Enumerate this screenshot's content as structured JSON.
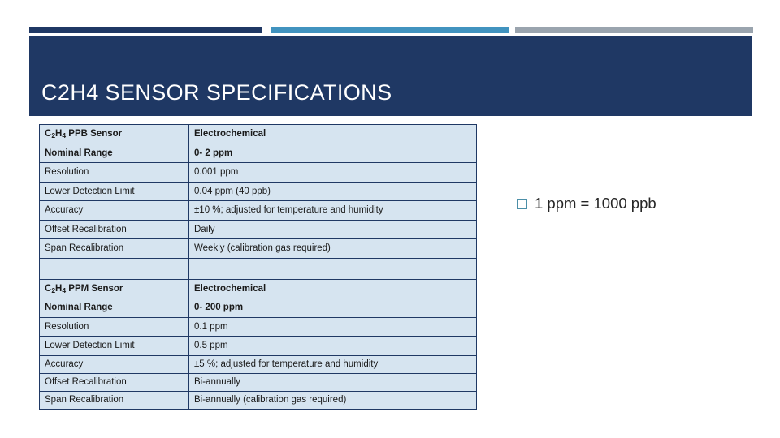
{
  "slide": {
    "title": "C2H4 SENSOR SPECIFICATIONS",
    "colors": {
      "navy": "#1f3864",
      "blue": "#4193bf",
      "gray": "#9aa4ae",
      "table_fill": "#d6e4f0",
      "bullet_outline": "#4c8fa8",
      "title_text": "#ffffff"
    }
  },
  "table": {
    "rows": [
      {
        "label_html": "C<sub>2</sub>H<sub>4</sub> PPB Sensor",
        "label_text": "C2H4 PPB Sensor",
        "value": "Electrochemical",
        "bold": true,
        "size": "tall"
      },
      {
        "label_html": "Nominal Range",
        "label_text": "Nominal Range",
        "value": "0- 2 ppm",
        "bold": true,
        "size": "tall"
      },
      {
        "label_html": "Resolution",
        "label_text": "Resolution",
        "value": "0.001 ppm",
        "bold": false,
        "size": "tall"
      },
      {
        "label_html": "Lower Detection Limit",
        "label_text": "Lower Detection Limit",
        "value": "0.04 ppm (40 ppb)",
        "bold": false,
        "size": "tall"
      },
      {
        "label_html": "Accuracy",
        "label_text": "Accuracy",
        "value": "±10 %; adjusted for temperature and humidity",
        "bold": false,
        "size": "tall"
      },
      {
        "label_html": "Offset Recalibration",
        "label_text": "Offset Recalibration",
        "value": "Daily",
        "bold": false,
        "size": "tall"
      },
      {
        "label_html": "Span Recalibration",
        "label_text": "Span Recalibration",
        "value": "Weekly (calibration gas required)",
        "bold": false,
        "size": "tall"
      },
      {
        "label_html": "",
        "label_text": "",
        "value": "",
        "bold": false,
        "size": "blank"
      },
      {
        "label_html": "C<sub>2</sub>H<sub>4</sub> PPM Sensor",
        "label_text": "C2H4 PPM Sensor",
        "value": "Electrochemical",
        "bold": true,
        "size": "tall"
      },
      {
        "label_html": "Nominal Range",
        "label_text": "Nominal Range",
        "value": "0- 200 ppm",
        "bold": true,
        "size": "tall"
      },
      {
        "label_html": "Resolution",
        "label_text": "Resolution",
        "value": "0.1 ppm",
        "bold": false,
        "size": "tall"
      },
      {
        "label_html": "Lower Detection Limit",
        "label_text": "Lower Detection Limit",
        "value": "0.5 ppm",
        "bold": false,
        "size": "tall"
      },
      {
        "label_html": "Accuracy",
        "label_text": "Accuracy",
        "value": "±5 %; adjusted for temperature and humidity",
        "bold": false,
        "size": "short"
      },
      {
        "label_html": "Offset Recalibration",
        "label_text": "Offset Recalibration",
        "value": "Bi-annually",
        "bold": false,
        "size": "short"
      },
      {
        "label_html": "Span Recalibration",
        "label_text": "Span Recalibration",
        "value": "Bi-annually (calibration gas required)",
        "bold": false,
        "size": "short"
      }
    ]
  },
  "side_note": {
    "bullet_icon": "hollow-square-bullet-icon",
    "text": "1 ppm = 1000 ppb"
  }
}
